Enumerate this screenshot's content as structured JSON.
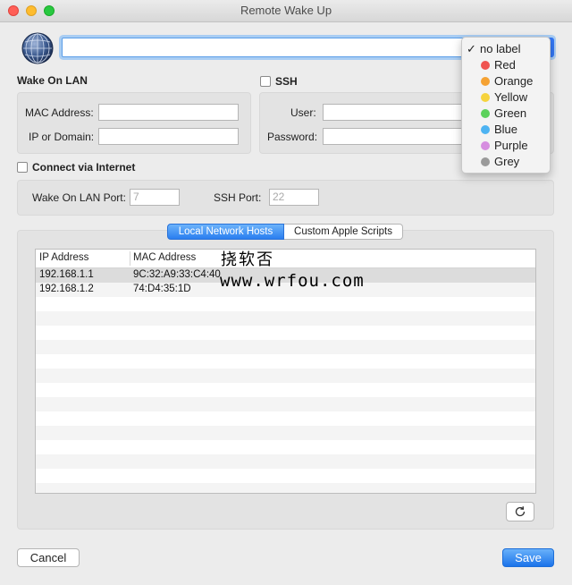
{
  "window": {
    "title": "Remote Wake Up"
  },
  "wol": {
    "title": "Wake On LAN",
    "mac_label": "MAC Address:",
    "ip_label": "IP or Domain:"
  },
  "ssh": {
    "title": "SSH",
    "user_label": "User:",
    "password_label": "Password:"
  },
  "internet": {
    "label": "Connect via Internet",
    "wol_port_label": "Wake On LAN Port:",
    "wol_port_placeholder": "7",
    "ssh_port_label": "SSH Port:",
    "ssh_port_placeholder": "22"
  },
  "tabs": {
    "local": "Local Network Hosts",
    "scripts": "Custom Apple Scripts"
  },
  "table": {
    "headers": [
      "IP Address",
      "MAC Address"
    ],
    "rows": [
      {
        "ip": "192.168.1.1",
        "mac": "9C:32:A9:33:C4:40"
      },
      {
        "ip": "192.168.1.2",
        "mac": "74:D4:35:1D"
      }
    ]
  },
  "buttons": {
    "cancel": "Cancel",
    "save": "Save"
  },
  "watermark": {
    "line1": "挠软否",
    "line2": "www.wrfou.com"
  },
  "label_menu": {
    "selected": "no label",
    "items": [
      {
        "label": "no label",
        "color": ""
      },
      {
        "label": "Red",
        "color": "#ef5350"
      },
      {
        "label": "Orange",
        "color": "#f5a233"
      },
      {
        "label": "Yellow",
        "color": "#f6d33d"
      },
      {
        "label": "Green",
        "color": "#5bd15b"
      },
      {
        "label": "Blue",
        "color": "#4db3f2"
      },
      {
        "label": "Purple",
        "color": "#d68ee0"
      },
      {
        "label": "Grey",
        "color": "#9a9a9a"
      }
    ]
  },
  "icons": {
    "globe": "network-globe-icon",
    "refresh": "refresh-icon",
    "check": "checkmark-icon"
  },
  "colors": {
    "accent": "#2a7ef0",
    "close": "#ff5f57",
    "minimize": "#febc2e",
    "maximize": "#28c840"
  }
}
